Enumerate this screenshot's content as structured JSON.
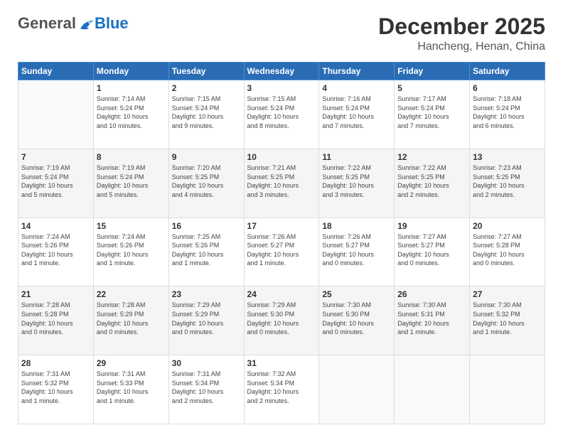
{
  "header": {
    "logo_general": "General",
    "logo_blue": "Blue",
    "month": "December 2025",
    "location": "Hancheng, Henan, China"
  },
  "days_of_week": [
    "Sunday",
    "Monday",
    "Tuesday",
    "Wednesday",
    "Thursday",
    "Friday",
    "Saturday"
  ],
  "weeks": [
    [
      {
        "day": "",
        "info": ""
      },
      {
        "day": "1",
        "info": "Sunrise: 7:14 AM\nSunset: 5:24 PM\nDaylight: 10 hours\nand 10 minutes."
      },
      {
        "day": "2",
        "info": "Sunrise: 7:15 AM\nSunset: 5:24 PM\nDaylight: 10 hours\nand 9 minutes."
      },
      {
        "day": "3",
        "info": "Sunrise: 7:15 AM\nSunset: 5:24 PM\nDaylight: 10 hours\nand 8 minutes."
      },
      {
        "day": "4",
        "info": "Sunrise: 7:16 AM\nSunset: 5:24 PM\nDaylight: 10 hours\nand 7 minutes."
      },
      {
        "day": "5",
        "info": "Sunrise: 7:17 AM\nSunset: 5:24 PM\nDaylight: 10 hours\nand 7 minutes."
      },
      {
        "day": "6",
        "info": "Sunrise: 7:18 AM\nSunset: 5:24 PM\nDaylight: 10 hours\nand 6 minutes."
      }
    ],
    [
      {
        "day": "7",
        "info": "Sunrise: 7:19 AM\nSunset: 5:24 PM\nDaylight: 10 hours\nand 5 minutes."
      },
      {
        "day": "8",
        "info": "Sunrise: 7:19 AM\nSunset: 5:24 PM\nDaylight: 10 hours\nand 5 minutes."
      },
      {
        "day": "9",
        "info": "Sunrise: 7:20 AM\nSunset: 5:25 PM\nDaylight: 10 hours\nand 4 minutes."
      },
      {
        "day": "10",
        "info": "Sunrise: 7:21 AM\nSunset: 5:25 PM\nDaylight: 10 hours\nand 3 minutes."
      },
      {
        "day": "11",
        "info": "Sunrise: 7:22 AM\nSunset: 5:25 PM\nDaylight: 10 hours\nand 3 minutes."
      },
      {
        "day": "12",
        "info": "Sunrise: 7:22 AM\nSunset: 5:25 PM\nDaylight: 10 hours\nand 2 minutes."
      },
      {
        "day": "13",
        "info": "Sunrise: 7:23 AM\nSunset: 5:25 PM\nDaylight: 10 hours\nand 2 minutes."
      }
    ],
    [
      {
        "day": "14",
        "info": "Sunrise: 7:24 AM\nSunset: 5:26 PM\nDaylight: 10 hours\nand 1 minute."
      },
      {
        "day": "15",
        "info": "Sunrise: 7:24 AM\nSunset: 5:26 PM\nDaylight: 10 hours\nand 1 minute."
      },
      {
        "day": "16",
        "info": "Sunrise: 7:25 AM\nSunset: 5:26 PM\nDaylight: 10 hours\nand 1 minute."
      },
      {
        "day": "17",
        "info": "Sunrise: 7:26 AM\nSunset: 5:27 PM\nDaylight: 10 hours\nand 1 minute."
      },
      {
        "day": "18",
        "info": "Sunrise: 7:26 AM\nSunset: 5:27 PM\nDaylight: 10 hours\nand 0 minutes."
      },
      {
        "day": "19",
        "info": "Sunrise: 7:27 AM\nSunset: 5:27 PM\nDaylight: 10 hours\nand 0 minutes."
      },
      {
        "day": "20",
        "info": "Sunrise: 7:27 AM\nSunset: 5:28 PM\nDaylight: 10 hours\nand 0 minutes."
      }
    ],
    [
      {
        "day": "21",
        "info": "Sunrise: 7:28 AM\nSunset: 5:28 PM\nDaylight: 10 hours\nand 0 minutes."
      },
      {
        "day": "22",
        "info": "Sunrise: 7:28 AM\nSunset: 5:29 PM\nDaylight: 10 hours\nand 0 minutes."
      },
      {
        "day": "23",
        "info": "Sunrise: 7:29 AM\nSunset: 5:29 PM\nDaylight: 10 hours\nand 0 minutes."
      },
      {
        "day": "24",
        "info": "Sunrise: 7:29 AM\nSunset: 5:30 PM\nDaylight: 10 hours\nand 0 minutes."
      },
      {
        "day": "25",
        "info": "Sunrise: 7:30 AM\nSunset: 5:30 PM\nDaylight: 10 hours\nand 0 minutes."
      },
      {
        "day": "26",
        "info": "Sunrise: 7:30 AM\nSunset: 5:31 PM\nDaylight: 10 hours\nand 1 minute."
      },
      {
        "day": "27",
        "info": "Sunrise: 7:30 AM\nSunset: 5:32 PM\nDaylight: 10 hours\nand 1 minute."
      }
    ],
    [
      {
        "day": "28",
        "info": "Sunrise: 7:31 AM\nSunset: 5:32 PM\nDaylight: 10 hours\nand 1 minute."
      },
      {
        "day": "29",
        "info": "Sunrise: 7:31 AM\nSunset: 5:33 PM\nDaylight: 10 hours\nand 1 minute."
      },
      {
        "day": "30",
        "info": "Sunrise: 7:31 AM\nSunset: 5:34 PM\nDaylight: 10 hours\nand 2 minutes."
      },
      {
        "day": "31",
        "info": "Sunrise: 7:32 AM\nSunset: 5:34 PM\nDaylight: 10 hours\nand 2 minutes."
      },
      {
        "day": "",
        "info": ""
      },
      {
        "day": "",
        "info": ""
      },
      {
        "day": "",
        "info": ""
      }
    ]
  ]
}
